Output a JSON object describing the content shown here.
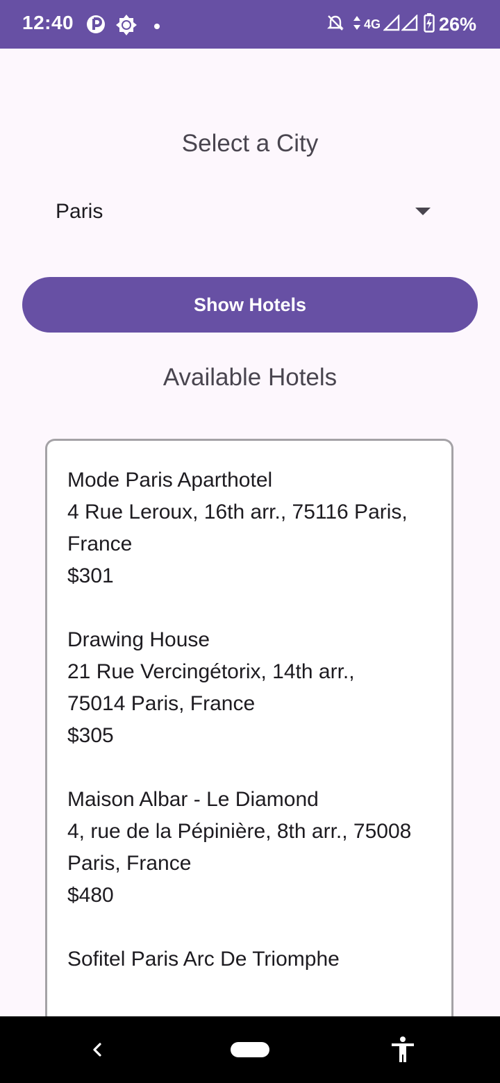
{
  "status_bar": {
    "time": "12:40",
    "network": "4G",
    "battery": "26%",
    "left_icons": [
      "notification-app-icon",
      "brightness-icon",
      "dot-icon"
    ],
    "right_icons": [
      "do-not-disturb-icon",
      "data-activity-icon",
      "signal-icon",
      "signal-icon",
      "battery-charging-icon"
    ]
  },
  "page": {
    "title": "Select a City",
    "city_select": {
      "value": "Paris",
      "icon": "dropdown-arrow-icon"
    },
    "show_button_label": "Show Hotels",
    "hotels_title": "Available Hotels",
    "hotels": [
      {
        "name": "Mode Paris Aparthotel",
        "address_line1": "4 Rue Leroux, 16th arr., 75116 Paris,",
        "address_line2": "France",
        "price": "$301"
      },
      {
        "name": "Drawing House",
        "address_line1": "21 Rue Vercingétorix, 14th arr.,",
        "address_line2": "75014 Paris, France",
        "price": "$305"
      },
      {
        "name": "Maison Albar - Le Diamond",
        "address_line1": "4, rue de la Pépinière, 8th arr., 75008",
        "address_line2": "Paris, France",
        "price": "$480"
      },
      {
        "name": "Sofitel Paris Arc De Triomphe"
      }
    ]
  },
  "nav_bar": {
    "icons": [
      "back-icon",
      "home-icon",
      "accessibility-icon"
    ]
  },
  "colors": {
    "primary": "#6750a4",
    "background": "#fdf7fd",
    "text": "#1d1b20",
    "secondary_text": "#49454f"
  }
}
